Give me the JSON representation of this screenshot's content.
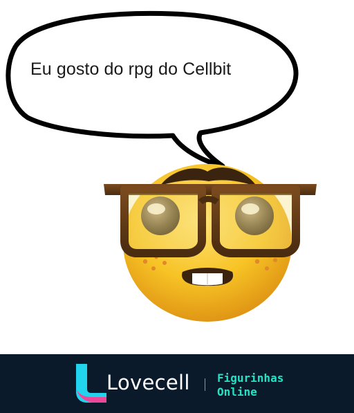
{
  "sticker": {
    "speech_text": "Eu gosto do rpg do Cellbit",
    "icon": "nerd-face-emoji-icon"
  },
  "footer": {
    "brand": "Lovecell",
    "tagline_line1": "Figurinhas",
    "tagline_line2": "Online",
    "logo_icon": "lovecell-logo-icon"
  },
  "colors": {
    "footer_background": "#0b1a2a",
    "tagline": "#22e3c3",
    "logo_primary": "#22d3ee",
    "logo_secondary": "#ec4899",
    "face": "#f7c325",
    "glasses": "#5a3617"
  }
}
